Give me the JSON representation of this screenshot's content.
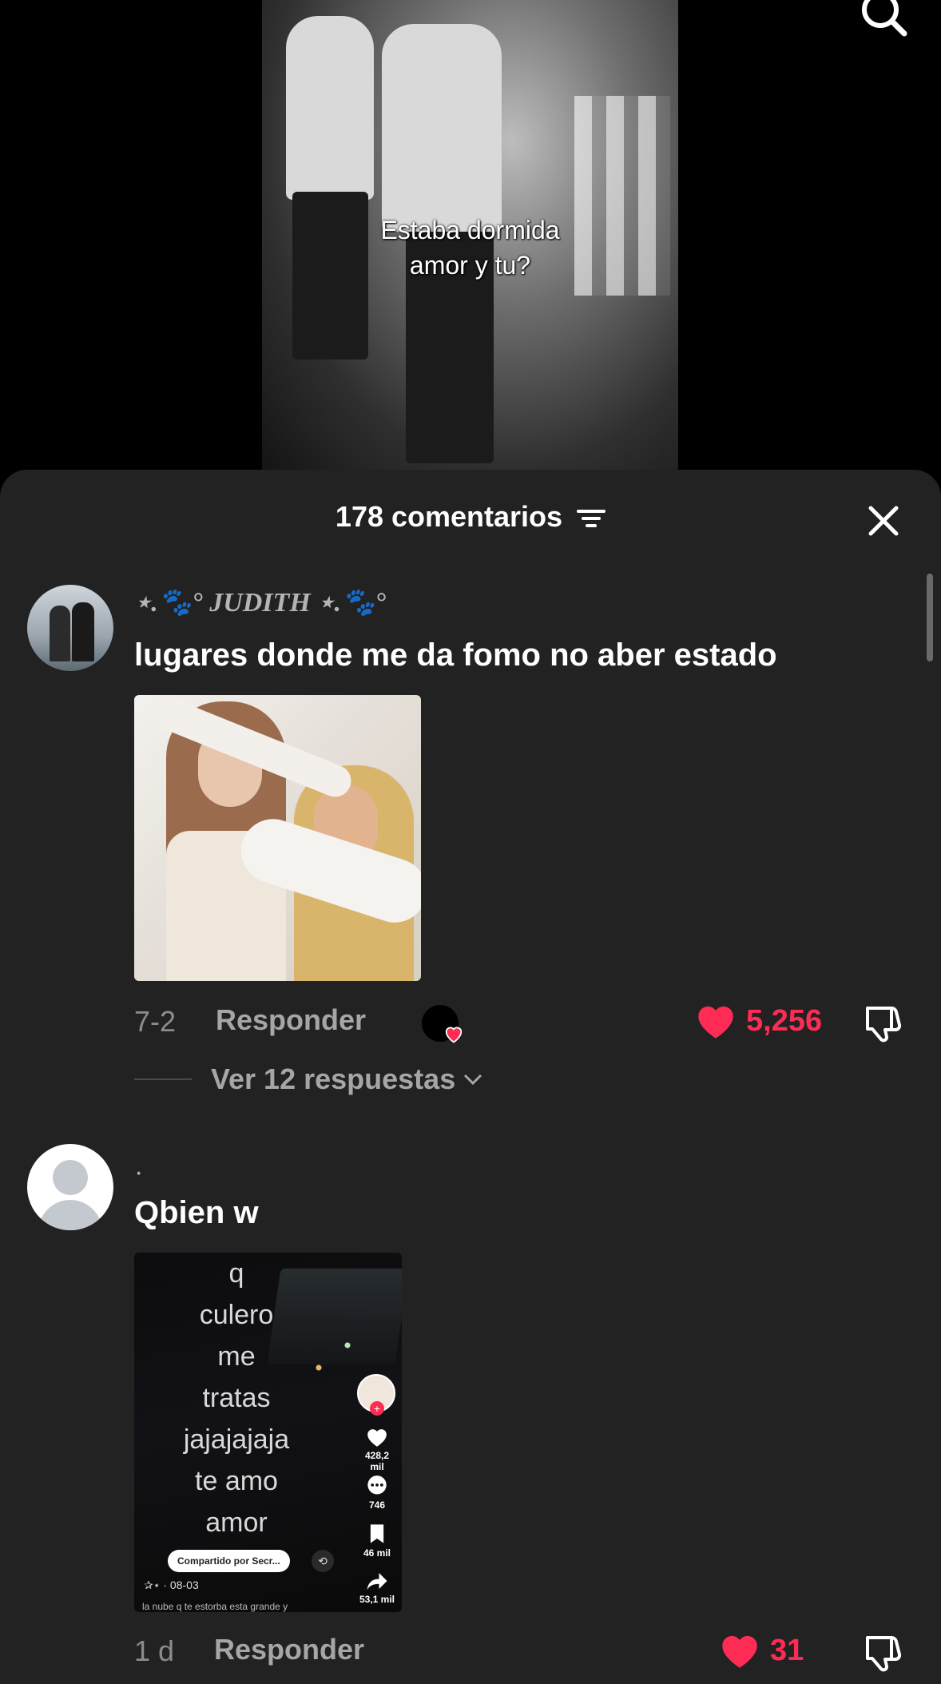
{
  "video": {
    "caption_line1": "Estaba dormida",
    "caption_line2": "amor y tu?"
  },
  "comments_sheet": {
    "title": "178 comentarios",
    "colors": {
      "like": "#fe2c55",
      "background": "#222223"
    }
  },
  "comments": [
    {
      "username": "⋆.🐾° JUDITH ⋆.🐾°",
      "text": "lugares donde me da fomo no aber estado",
      "date": "7-2",
      "reply_label": "Responder",
      "likes": "5,256",
      "view_replies": "Ver 12 respuestas"
    },
    {
      "username": "·",
      "text": "Qbien w",
      "date": "1 d",
      "reply_label": "Responder",
      "likes": "31",
      "shared_video": {
        "caption": [
          "q",
          "culero",
          "me",
          "tratas",
          "jajajajaja",
          "te amo",
          "amor"
        ],
        "likes": "428,2 mil",
        "comments": "746",
        "saves": "46 mil",
        "shares": "53,1 mil",
        "shared_by": "Compartido por Secr...",
        "date": "✰⋆ · 08-03",
        "truncated_caption": "la nube q te estorba esta grande y"
      }
    }
  ]
}
